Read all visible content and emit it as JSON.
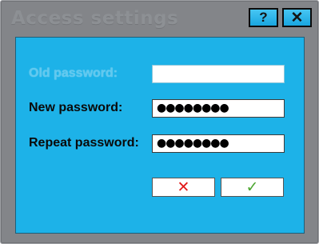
{
  "window": {
    "title": "Access settings",
    "help_label": "?",
    "close_label": "✕"
  },
  "form": {
    "old_password": {
      "label": "Old password:",
      "value": "",
      "enabled": false
    },
    "new_password": {
      "label": "New password:",
      "value": "●●●●●●●●"
    },
    "repeat_password": {
      "label": "Repeat password:",
      "value": "●●●●●●●●"
    }
  },
  "actions": {
    "cancel_icon": "✕",
    "ok_icon": "✓"
  },
  "icons": {
    "help": "question-mark-icon",
    "close": "close-icon",
    "cancel": "red-cross-icon",
    "ok": "green-check-icon"
  },
  "colors": {
    "panel": "#1db2e8",
    "window": "#838589",
    "cancel": "#e21b1b",
    "ok": "#4aa52e"
  }
}
